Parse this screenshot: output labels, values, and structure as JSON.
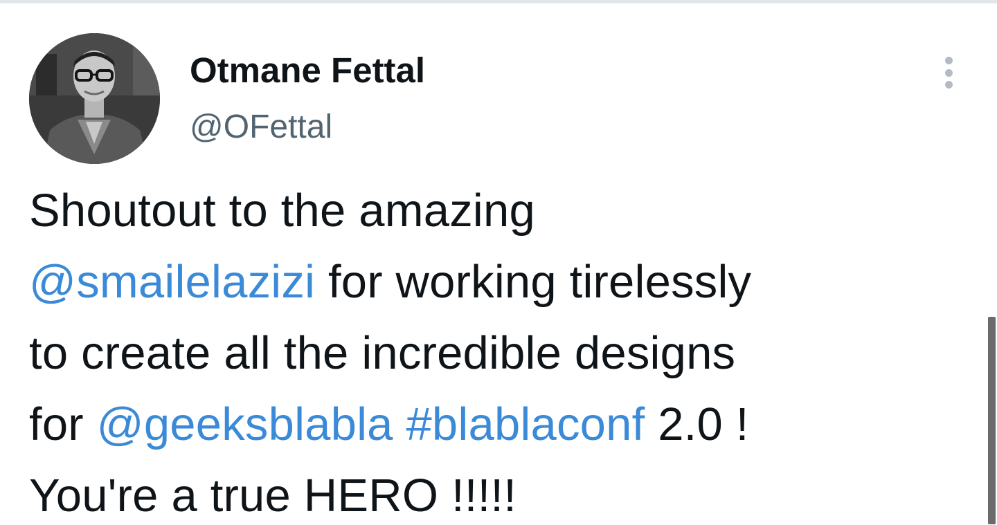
{
  "tweet": {
    "author": {
      "display_name": "Otmane Fettal",
      "handle": "@OFettal",
      "avatar_icon": "user-photo"
    },
    "more_icon": "vertical-ellipsis-icon",
    "text": {
      "line1": "Shoutout to the amazing",
      "mention_smail": "@smailelazizi",
      "line2_rest": " for working tirelessly",
      "line3": "to create all the incredible designs",
      "line4_prefix": "for ",
      "mention_geeks": "@geeksblabla",
      "line4_space": " ",
      "hashtag": "#blablaconf",
      "line4_suffix": " 2.0 !",
      "line5": "You're a true HERO !!!!!"
    }
  },
  "colors": {
    "text": "#0f1419",
    "secondary": "#536471",
    "link": "#3b8ad8",
    "divider": "#e1e6ea",
    "more_icon": "#b3bcc4",
    "scrollbar": "#6b6b6b"
  }
}
